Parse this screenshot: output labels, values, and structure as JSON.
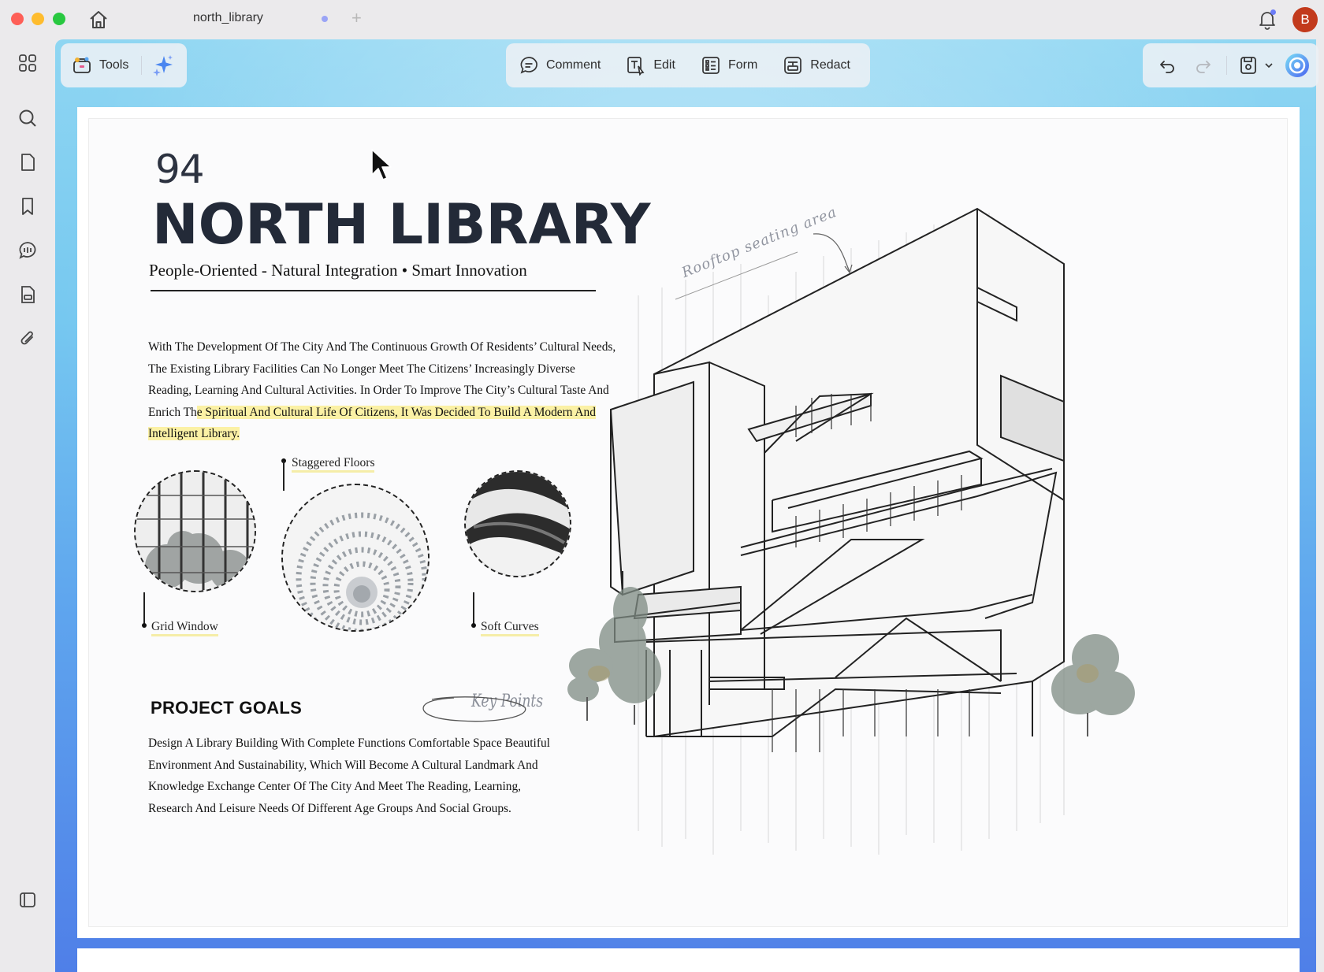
{
  "window": {
    "tab_title": "north_library",
    "avatar_initial": "B"
  },
  "toolbar_left": {
    "tools_label": "Tools"
  },
  "toolbar_center": {
    "comment_label": "Comment",
    "edit_label": "Edit",
    "form_label": "Form",
    "redact_label": "Redact"
  },
  "document": {
    "page_number": "94",
    "title": "NORTH LIBRARY",
    "subtitle": "People-Oriented - Natural Integration • Smart Innovation",
    "intro_plain": "With The Development Of The City And The Continuous Growth Of Residents’ Cultural Needs, The Existing Library Facilities Can No Longer Meet The Citizens’ Increasingly Diverse Reading, Learning And Cultural Activities. In Order To Improve The City’s Cultural Taste And Enrich Th",
    "intro_highlighted": "e Spiritual And Cultural Life Of Citizens, It Was Decided To Build A Modern And Intelligent Library.",
    "labels": {
      "staggered_floors": "Staggered Floors",
      "grid_window": "Grid Window",
      "soft_curves": "Soft Curves"
    },
    "goals_title": "PROJECT GOALS",
    "key_points": "Key Points",
    "goals_text": "Design A Library Building With Complete Functions Comfortable Space Beautiful Environment And Sustainability, Which Will Become A Cultural Landmark And Knowledge Exchange Center Of The City And Meet The Reading, Learning, Research And Leisure Needs Of Different Age Groups And Social Groups.",
    "rooftop_note": "Rooftop seating area"
  },
  "icons": {
    "sidebar": [
      "grid-icon",
      "search-icon",
      "page-icon",
      "bookmark-icon",
      "comment-icon",
      "form-icon",
      "attachment-icon"
    ],
    "sidebar_bottom": "theme-icon"
  },
  "colors": {
    "highlight": "#fbf1a5",
    "avatar": "#c23a1c",
    "accent": "#6b7cf7"
  }
}
